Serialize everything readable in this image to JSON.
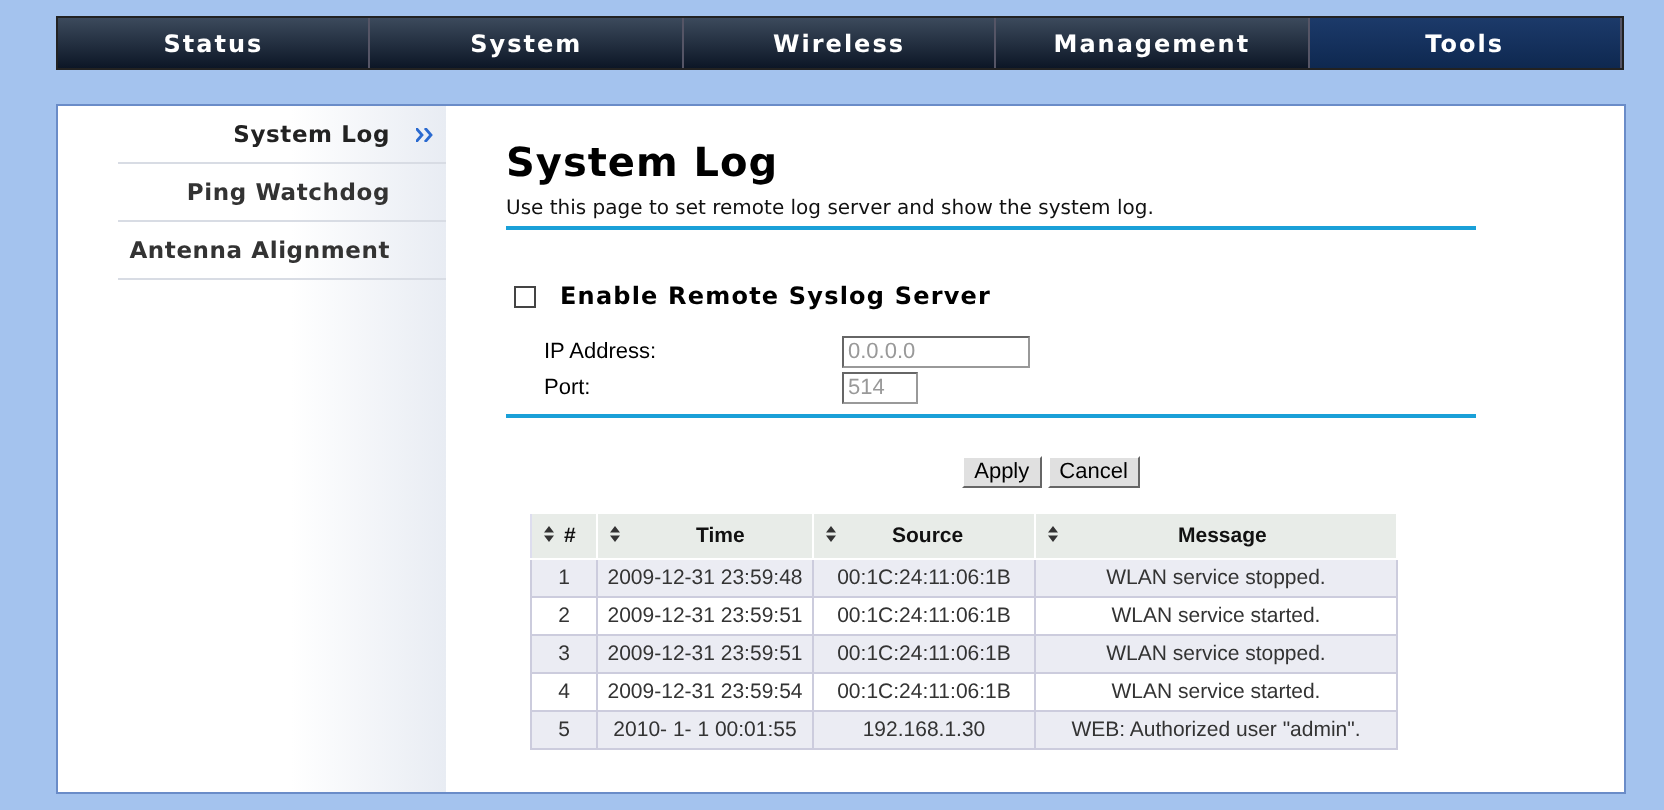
{
  "nav_tabs": [
    {
      "label": "Status",
      "selected": false
    },
    {
      "label": "System",
      "selected": false
    },
    {
      "label": "Wireless",
      "selected": false
    },
    {
      "label": "Management",
      "selected": false
    },
    {
      "label": "Tools",
      "selected": true
    }
  ],
  "sidebar": {
    "items": [
      {
        "label": "System Log",
        "selected": true
      },
      {
        "label": "Ping Watchdog",
        "selected": false
      },
      {
        "label": "Antenna Alignment",
        "selected": false
      }
    ]
  },
  "page": {
    "title": "System Log",
    "description": "Use this page to set remote log server and show the system log."
  },
  "remote_syslog": {
    "label": "Enable Remote Syslog Server",
    "checked": false,
    "fields": [
      {
        "label": "IP Address:",
        "value": "0.0.0.0",
        "disabled": true,
        "kind": "wide"
      },
      {
        "label": "Port:",
        "value": "514",
        "disabled": true,
        "kind": "narrow"
      }
    ]
  },
  "buttons": [
    "Apply",
    "Cancel"
  ],
  "table": {
    "columns": [
      "#",
      "Time",
      "Source",
      "Message"
    ],
    "rows": [
      [
        "1",
        "2009-12-31 23:59:48",
        "00:1C:24:11:06:1B",
        "WLAN service stopped."
      ],
      [
        "2",
        "2009-12-31 23:59:51",
        "00:1C:24:11:06:1B",
        "WLAN service started."
      ],
      [
        "3",
        "2009-12-31 23:59:51",
        "00:1C:24:11:06:1B",
        "WLAN service stopped."
      ],
      [
        "4",
        "2009-12-31 23:59:54",
        "00:1C:24:11:06:1B",
        "WLAN service started."
      ],
      [
        "5",
        "2010- 1- 1 00:01:55",
        "192.168.1.30",
        "WEB: Authorized user \"admin\"."
      ]
    ]
  }
}
